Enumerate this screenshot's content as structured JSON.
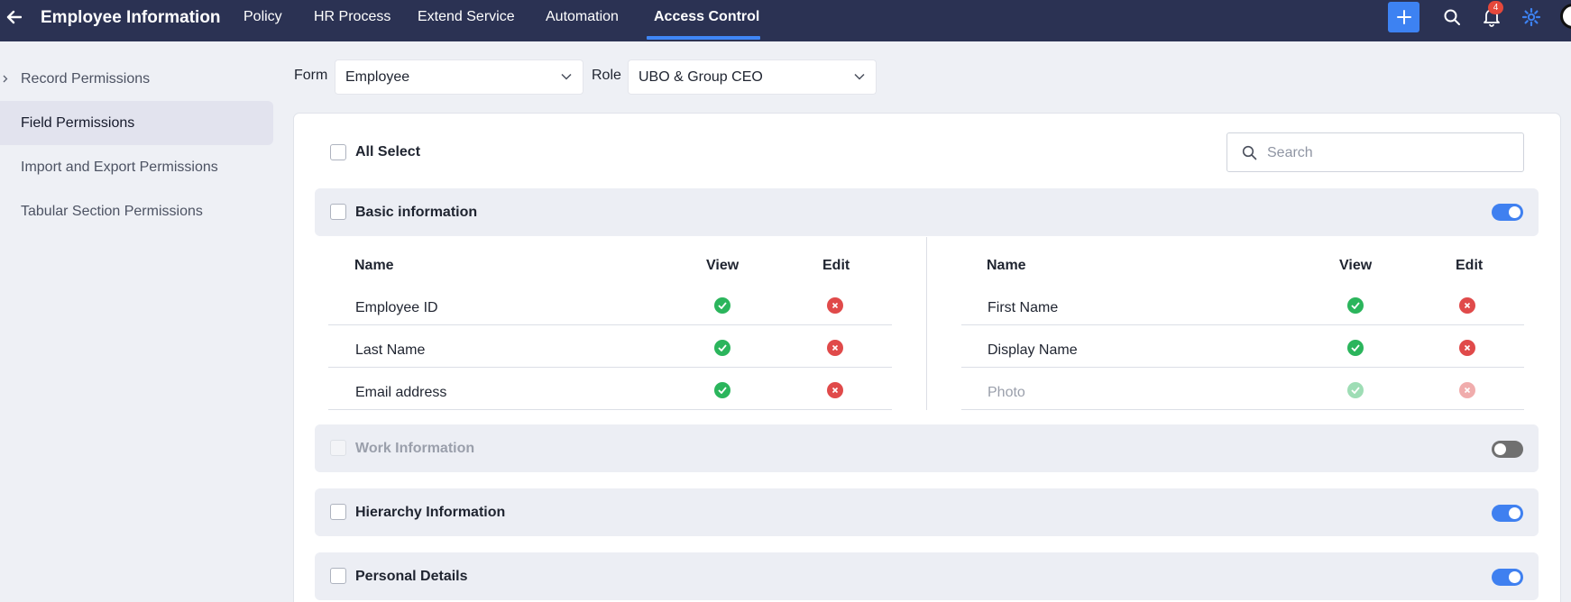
{
  "header": {
    "title": "Employee Information",
    "tabs": [
      {
        "label": "Policy",
        "active": false
      },
      {
        "label": "HR Process",
        "active": false
      },
      {
        "label": "Extend Service",
        "active": false
      },
      {
        "label": "Automation",
        "active": false
      },
      {
        "label": "Access Control",
        "active": true
      }
    ],
    "notification_count": "4",
    "accent_color": "#3d82f2"
  },
  "sidebar": {
    "items": [
      {
        "label": "Record Permissions",
        "active": false,
        "expandable": true
      },
      {
        "label": "Field Permissions",
        "active": true
      },
      {
        "label": "Import and Export Permissions",
        "active": false
      },
      {
        "label": "Tabular Section Permissions",
        "active": false
      }
    ]
  },
  "filters": {
    "form_label": "Form",
    "form_value": "Employee",
    "role_label": "Role",
    "role_value": "UBO & Group CEO"
  },
  "panel": {
    "all_select_label": "All Select",
    "search_placeholder": "Search",
    "sections": [
      {
        "title": "Basic information",
        "enabled": true,
        "expanded": true
      },
      {
        "title": "Work Information",
        "enabled": false,
        "expanded": false
      },
      {
        "title": "Hierarchy Information",
        "enabled": true,
        "expanded": false
      },
      {
        "title": "Personal Details",
        "enabled": true,
        "expanded": false
      }
    ],
    "columns": {
      "name": "Name",
      "view": "View",
      "edit": "Edit"
    },
    "left_fields": [
      {
        "name": "Employee ID",
        "view": "allowed",
        "edit": "denied"
      },
      {
        "name": "Last Name",
        "view": "allowed",
        "edit": "denied"
      },
      {
        "name": "Email address",
        "view": "allowed",
        "edit": "denied"
      }
    ],
    "right_fields": [
      {
        "name": "First Name",
        "view": "allowed",
        "edit": "denied"
      },
      {
        "name": "Display Name",
        "view": "allowed",
        "edit": "denied"
      },
      {
        "name": "Photo",
        "view": "allowed",
        "edit": "denied",
        "disabled": true
      }
    ]
  },
  "icons": {
    "back": "arrow-left-icon",
    "add": "plus-icon",
    "search": "search-icon",
    "notifications": "bell-icon",
    "settings": "gear-icon",
    "allowed": "check-circle-icon",
    "denied": "x-circle-icon"
  }
}
